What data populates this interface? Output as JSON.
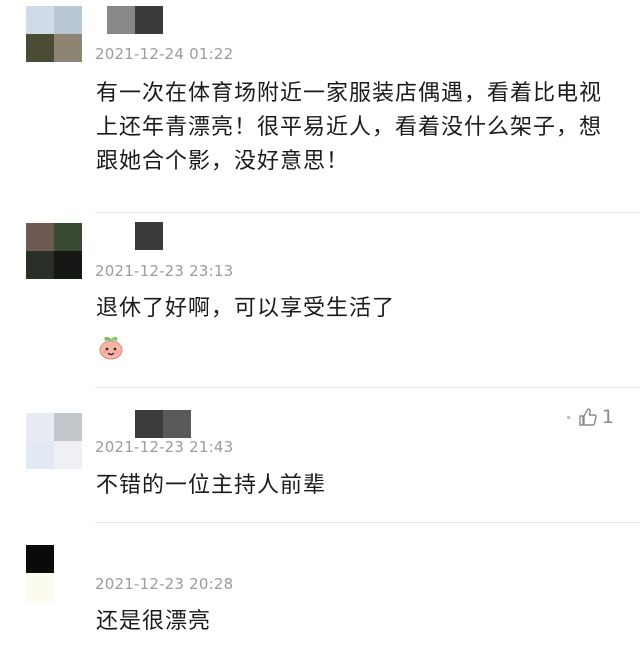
{
  "comments": [
    {
      "timestamp": "2021-12-24 01:22",
      "text": "有一次在体育场附近一家服装店偶遇，看着比电视上还年青漂亮！很平易近人，看着没什么架子，想跟她合个影，没好意思！"
    },
    {
      "timestamp": "2021-12-23 23:13",
      "text": "退休了好啊，可以享受生活了",
      "emoji": "smiling-sprout-emoji"
    },
    {
      "timestamp": "2021-12-23 21:43",
      "text": "不错的一位主持人前辈",
      "like_count": "1"
    },
    {
      "timestamp": "2021-12-23 20:28",
      "text": "还是很漂亮"
    }
  ],
  "colors": {
    "timestamp": "#9c9c9c",
    "divider": "#e6e6e6",
    "text": "#1b1b1b"
  }
}
